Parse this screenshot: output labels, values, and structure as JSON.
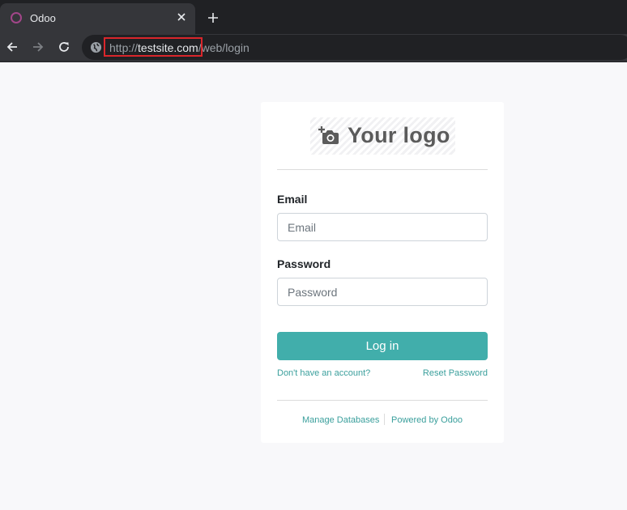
{
  "browser": {
    "tab": {
      "title": "Odoo"
    },
    "url": {
      "scheme": "http://",
      "host": "testsite.com",
      "path": "/web/login"
    },
    "colors": {
      "highlight": "#d9262b",
      "favicon": "#a24689"
    }
  },
  "login": {
    "logo_text": "Your logo",
    "logo_icon": "camera-add-icon",
    "email": {
      "label": "Email",
      "placeholder": "Email",
      "value": ""
    },
    "password": {
      "label": "Password",
      "placeholder": "Password",
      "value": ""
    },
    "login_button": "Log in",
    "signup_link": "Don't have an account?",
    "reset_link": "Reset Password",
    "manage_link": "Manage Databases",
    "powered_link": "Powered by Odoo",
    "colors": {
      "primary": "#41aeab",
      "link": "#3a9f9c"
    }
  }
}
